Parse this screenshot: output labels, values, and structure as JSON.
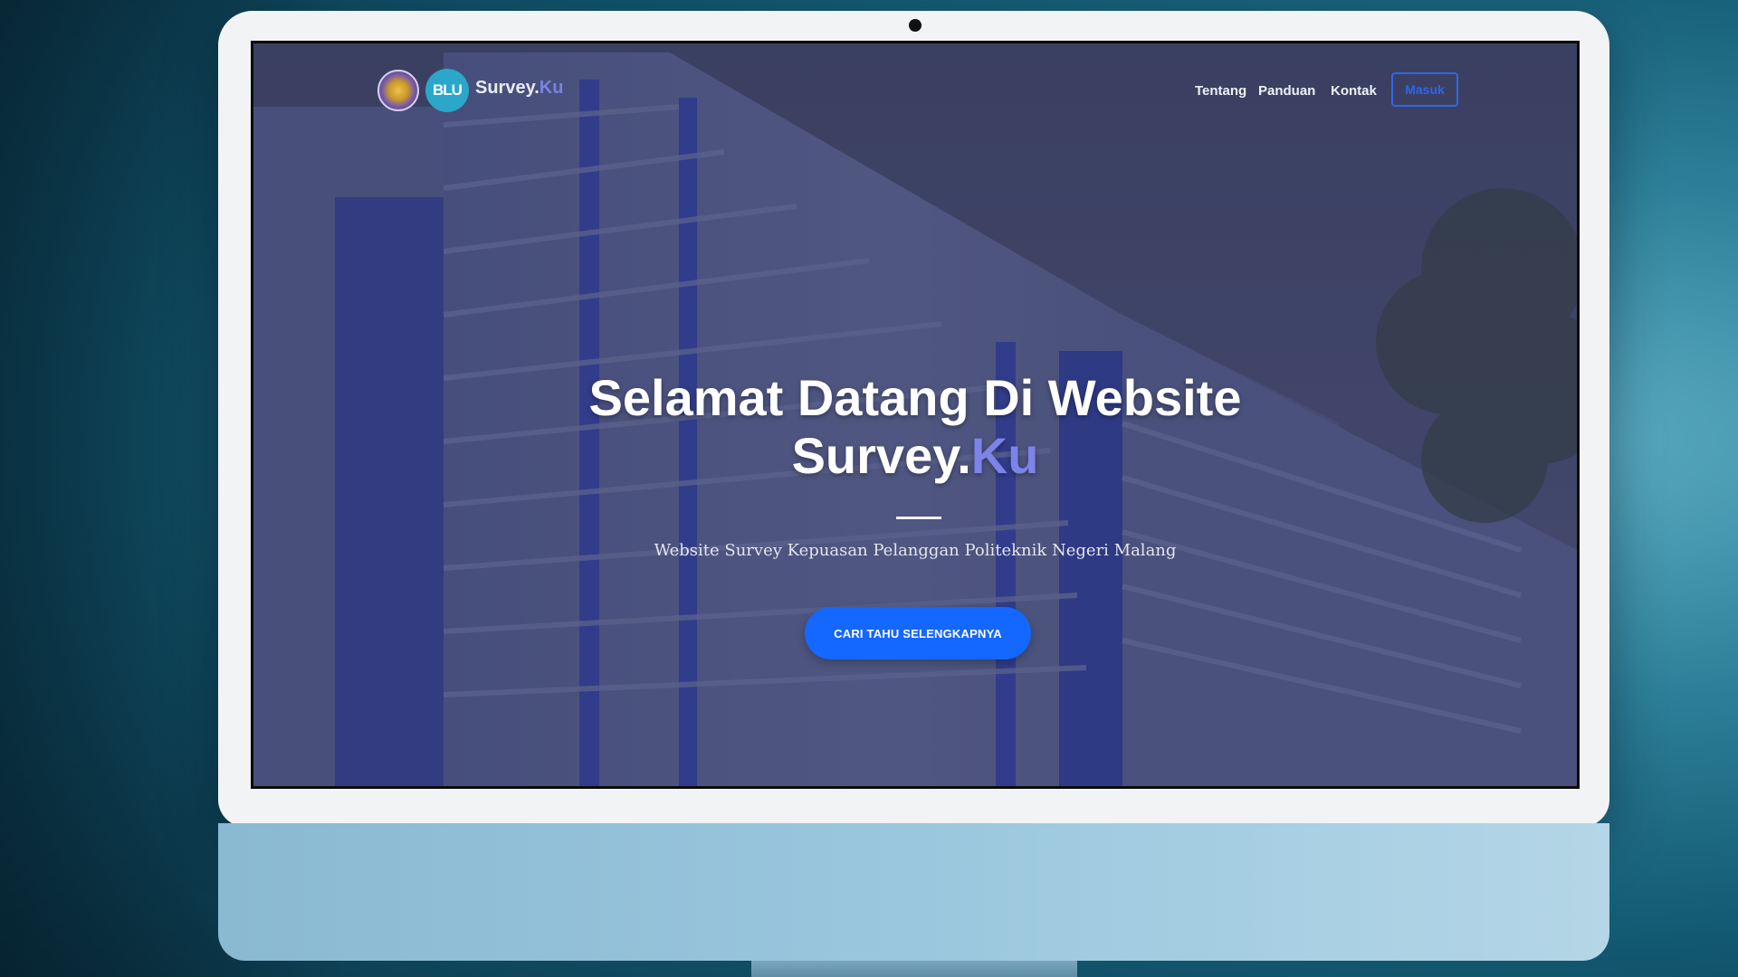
{
  "nav": {
    "logo_seal_icon": "polinema-seal-icon",
    "logo_blu_text": "BLU",
    "brand_main": "Survey.",
    "brand_accent": "Ku",
    "links": [
      "Tentang",
      "Panduan",
      "Kontak"
    ],
    "login_label": "Masuk"
  },
  "hero": {
    "title_line1": "Selamat Datang Di Website",
    "title_line2_main": "Survey.",
    "title_line2_accent": "Ku",
    "subtitle": "Website Survey Kepuasan Pelanggan Politeknik Negeri Malang",
    "cta_label": "CARI TAHU SELENGKAPNYA"
  },
  "colors": {
    "accent": "#7a82e6",
    "primary_button": "#1467ff",
    "login_border": "#2f66e8"
  }
}
